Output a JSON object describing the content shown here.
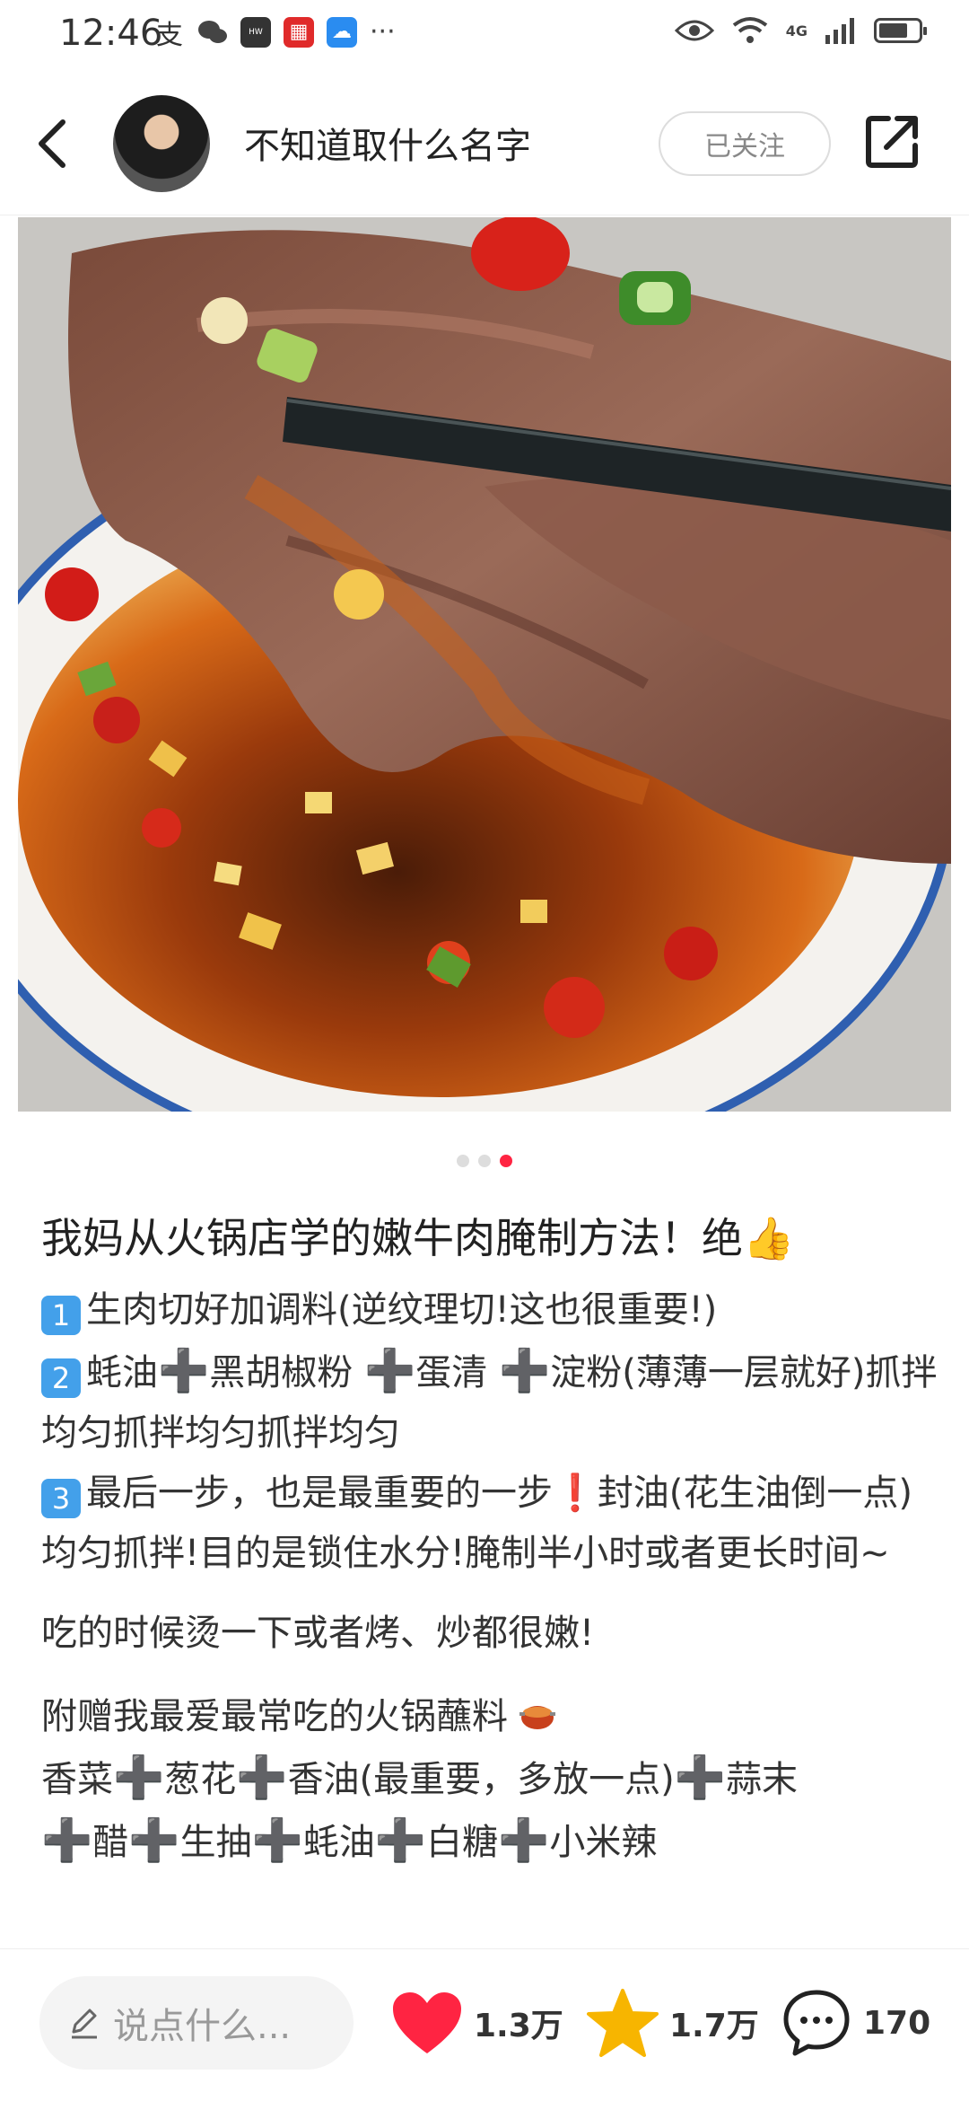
{
  "status_bar": {
    "time": "12:46",
    "network": "4G",
    "icons": [
      "alipay-icon",
      "wechat-icon",
      "huawei-app-icon",
      "store-icon",
      "weather-icon",
      "more-dots",
      "eye-icon",
      "wifi-icon",
      "signal-icon",
      "battery-icon"
    ]
  },
  "header": {
    "username": "不知道取什么名字",
    "follow_label": "已关注"
  },
  "carousel": {
    "total": 3,
    "active": 3
  },
  "post": {
    "title": "我妈从火锅店学的嫩牛肉腌制方法！绝👍",
    "steps": [
      {
        "num": "1",
        "text": "生肉切好加调料(逆纹理切!这也很重要!)"
      },
      {
        "num": "2",
        "text_a": "蚝油",
        "text_b": "黑胡椒粉 ",
        "text_c": "蛋清 ",
        "text_d": "淀粉(薄薄一层就好)抓拌均匀抓拌均匀抓拌均匀"
      },
      {
        "num": "3",
        "text_a": "最后一步，也是最重要的一步",
        "text_b": "封油(花生油倒一点)均匀抓拌!目的是锁住水分!腌制半小时或者更长时间~"
      }
    ],
    "para_eat": "吃的时候烫一下或者烤、炒都很嫩!",
    "dip_title": "附赠我最爱最常吃的火锅蘸料",
    "dip_items": [
      "香菜",
      "葱花",
      "香油(最重要，多放一点)",
      "蒜末",
      "醋",
      "生抽",
      "蚝油",
      "白糖",
      "小米辣"
    ]
  },
  "bottom_bar": {
    "comment_placeholder": "说点什么...",
    "likes": "1.3万",
    "collects": "1.7万",
    "comments": "170"
  },
  "colors": {
    "accent": "#ff2442",
    "like": "#ff2442",
    "star": "#f7b500",
    "keycap": "#43a0ea"
  }
}
